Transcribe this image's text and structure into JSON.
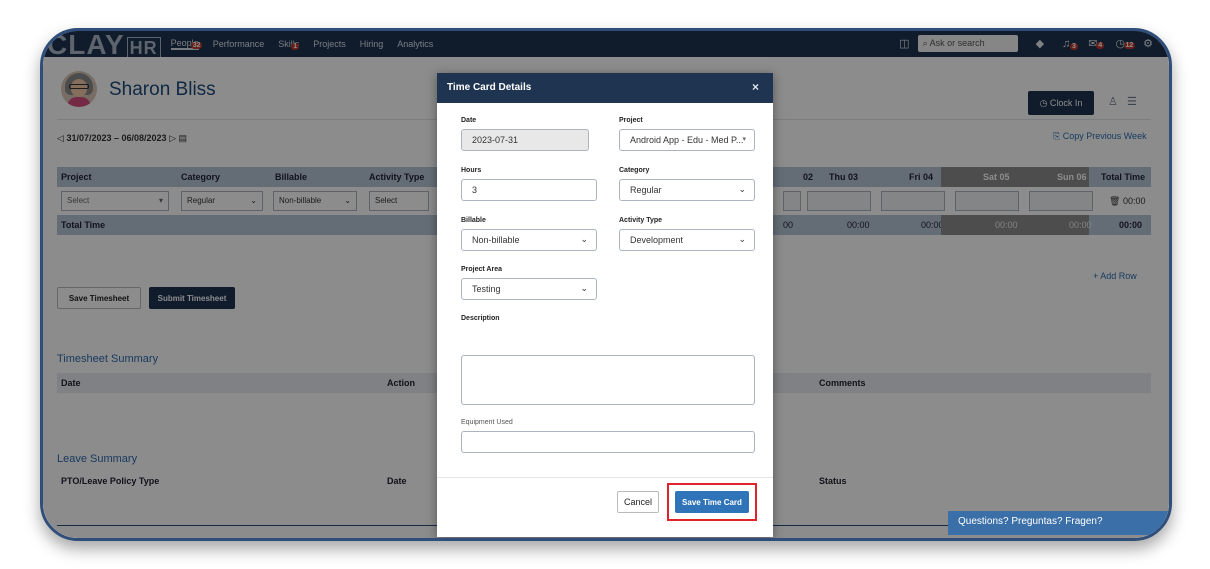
{
  "topbar": {
    "logo": "CLAY",
    "logo_suffix": "HR",
    "nav": [
      {
        "label": "People",
        "badge": "32"
      },
      {
        "label": "Performance",
        "badge": ""
      },
      {
        "label": "Skills",
        "badge": "1"
      },
      {
        "label": "Projects",
        "badge": ""
      },
      {
        "label": "Hiring",
        "badge": ""
      },
      {
        "label": "Analytics",
        "badge": ""
      }
    ],
    "search_placeholder": "Ask or search",
    "icon_badges": {
      "bell": "3",
      "mail": "4",
      "approvals": "12"
    }
  },
  "header": {
    "name": "Sharon Bliss",
    "clock_in": "Clock In",
    "date_range": "31/07/2023 – 06/08/2023",
    "copy_previous_week": "Copy Previous Week"
  },
  "timesheet": {
    "columns": [
      "Project",
      "Category",
      "Billable",
      "Activity Type",
      "02",
      "Thu 03",
      "Fri 04",
      "Sat 05",
      "Sun 06",
      "Total Time"
    ],
    "row": {
      "project": "Select",
      "category": "Regular",
      "billable": "Non-billable",
      "activity": "Select",
      "total": "00:00"
    },
    "total_label": "Total Time",
    "totals": [
      "00",
      "00:00",
      "00:00",
      "00:00",
      "00:00",
      "00:00"
    ],
    "add_row": "+ Add Row",
    "save_button": "Save Timesheet",
    "submit_button": "Submit Timesheet"
  },
  "summary": {
    "title": "Timesheet Summary",
    "columns": [
      "Date",
      "Action",
      "Comments"
    ]
  },
  "leave": {
    "title": "Leave Summary",
    "columns": [
      "PTO/Leave Policy Type",
      "Date",
      "Status"
    ]
  },
  "help_bar": "Questions? Preguntas? Fragen?",
  "modal": {
    "title": "Time Card Details",
    "close": "×",
    "date_label": "Date",
    "date_value": "2023-07-31",
    "project_label": "Project",
    "project_value": "Android App - Edu - Med P...",
    "hours_label": "Hours",
    "hours_value": "3",
    "category_label": "Category",
    "category_value": "Regular",
    "billable_label": "Billable",
    "billable_value": "Non-billable",
    "activity_label": "Activity Type",
    "activity_value": "Development",
    "area_label": "Project Area",
    "area_value": "Testing",
    "description_label": "Description",
    "equipment_label": "Equipment Used",
    "cancel": "Cancel",
    "save": "Save Time Card"
  }
}
